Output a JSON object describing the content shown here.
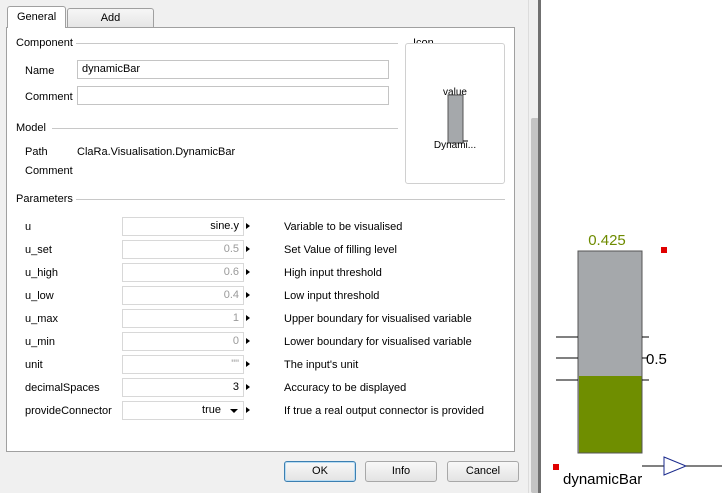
{
  "tabs": [
    {
      "label": "General"
    },
    {
      "label": "Add modifiers"
    }
  ],
  "component": {
    "section_label": "Component",
    "name_label": "Name",
    "name_value": "dynamicBar",
    "comment_label": "Comment",
    "comment_value": ""
  },
  "icon": {
    "section_label": "Icon",
    "value_text": "value",
    "name_text": "Dynami..."
  },
  "model": {
    "section_label": "Model",
    "path_label": "Path",
    "path_value": "ClaRa.Visualisation.DynamicBar",
    "comment_label": "Comment"
  },
  "parameters": {
    "section_label": "Parameters",
    "rows": [
      {
        "name": "u",
        "value": "sine.y",
        "desc": "Variable to be visualised"
      },
      {
        "name": "u_set",
        "value": "0.5",
        "desc": "Set Value of filling level"
      },
      {
        "name": "u_high",
        "value": "0.6",
        "desc": "High input threshold"
      },
      {
        "name": "u_low",
        "value": "0.4",
        "desc": "Low input threshold"
      },
      {
        "name": "u_max",
        "value": "1",
        "desc": "Upper boundary for visualised variable"
      },
      {
        "name": "u_min",
        "value": "0",
        "desc": "Lower boundary for visualised variable"
      },
      {
        "name": "unit",
        "value": "\"\"",
        "desc": "The input's unit"
      },
      {
        "name": "decimalSpaces",
        "value": "3",
        "desc": "Accuracy to be displayed"
      },
      {
        "name": "provideConnector",
        "value": "true",
        "desc": "If true a real output connector is provided"
      }
    ]
  },
  "buttons": {
    "ok": "OK",
    "info": "Info",
    "cancel": "Cancel"
  },
  "diagram": {
    "value_label": "0.425",
    "set_label": "0.5",
    "component_name": "dynamicBar",
    "fill_fraction": 0.425,
    "colors": {
      "value_text": "#6e8b00",
      "bar_empty": "#a5a8ab",
      "bar_fill": "#6f8e00",
      "selection_marker": "#e00000"
    }
  }
}
